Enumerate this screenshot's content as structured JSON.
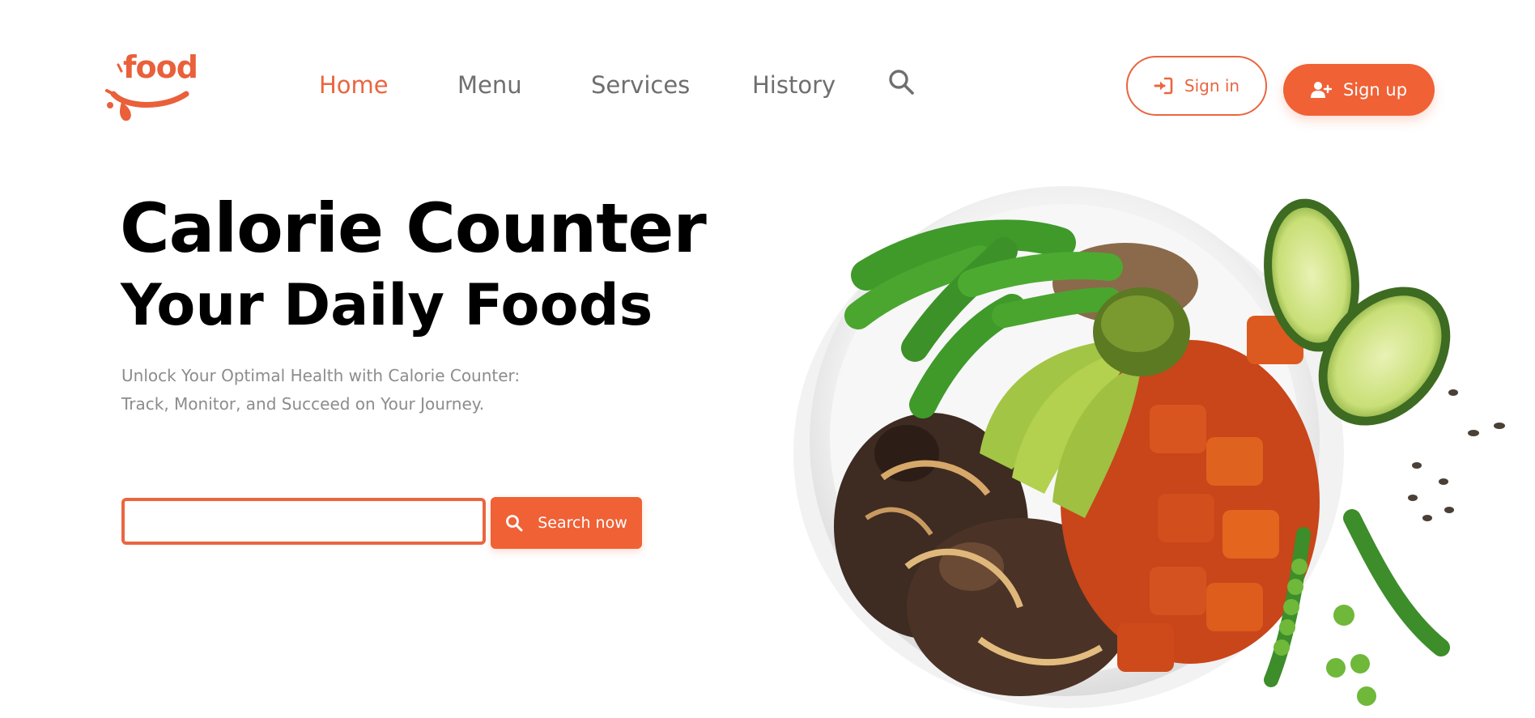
{
  "brand": {
    "logo_text": "food",
    "color": "#e9603a"
  },
  "nav": {
    "items": [
      {
        "label": "Home",
        "active": true
      },
      {
        "label": "Menu",
        "active": false
      },
      {
        "label": "Services",
        "active": false
      },
      {
        "label": "History",
        "active": false
      }
    ],
    "search_icon": "search-icon"
  },
  "auth": {
    "signin_label": "Sign in",
    "signin_icon": "sign-in-icon",
    "signup_label": "Sign up",
    "signup_icon": "user-plus-icon"
  },
  "hero": {
    "title": "Calorie Counter",
    "subtitle": "Your Daily Foods",
    "description_line1": "Unlock Your Optimal Health with Calorie Counter:",
    "description_line2": "Track, Monitor, and Succeed on Your Journey."
  },
  "search": {
    "value": "",
    "placeholder": "",
    "button_label": "Search now",
    "button_icon": "search-icon"
  },
  "image": {
    "subject": "food-bowl-illustration"
  },
  "colors": {
    "accent": "#f06135",
    "nav_active": "#e9663f",
    "nav_inactive": "#6f6f6f",
    "description": "#8c8c8c"
  }
}
